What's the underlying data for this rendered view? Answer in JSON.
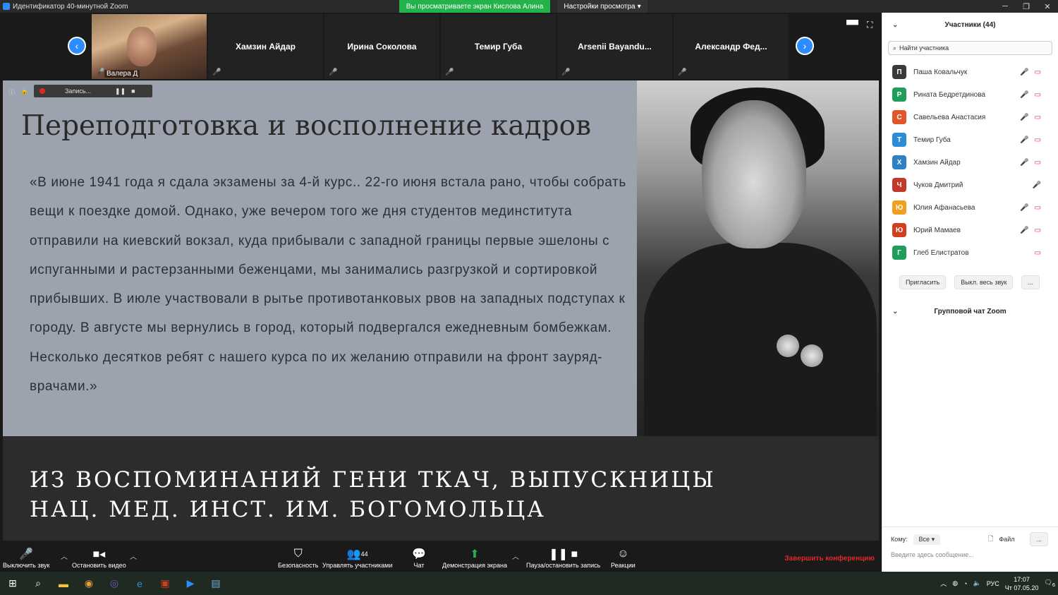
{
  "window": {
    "title": "Идентификатор 40-минутной Zoom",
    "share_notice": "Вы просматриваете экран Кислова Алина",
    "view_options": "Настройки просмотра"
  },
  "video_strip": {
    "self_name": "Валера Д",
    "tiles": [
      "Хамзин Айдар",
      "Ирина Соколова",
      "Темир Губа",
      "Arsenii  Bayandu...",
      "Александр  Фед..."
    ]
  },
  "recording": {
    "label": "Запись..."
  },
  "slide": {
    "title": "Переподготовка и восполнение кадров",
    "quote": "«В июне 1941 года я сдала экзамены за 4-й курс.. 22-го июня встала рано, чтобы собрать вещи к поездке домой. Однако, уже вечером того же дня студентов мединститута отправили на киевский вокзал, куда прибывали с западной границы первые эшелоны с испуганными и растерзанными беженцами, мы занимались разгрузкой и сортировкой прибывших. В июле участвовали в рытье противотанковых рвов на западных подступах к городу. В августе мы вернулись в город, который подвергался ежедневным бомбежкам. Несколько десятков ребят с нашего курса по их желанию отправили на фронт зауряд-врачами.»",
    "caption_line1": "ИЗ ВОСПОМИНАНИЙ  ГЕНИ ТКАЧ, ВЫПУСКНИЦЫ",
    "caption_line2": "НАЦ. МЕД. ИНСТ. ИМ. БОГОМОЛЬЦА"
  },
  "participants": {
    "header": "Участники (44)",
    "search_placeholder": "Найти участника",
    "list": [
      {
        "initial": "П",
        "name": "Паша Ковальчук",
        "color": "#3a3a3a"
      },
      {
        "initial": "Р",
        "name": "Рината Бедретдинова",
        "color": "#1e9e5a"
      },
      {
        "initial": "С",
        "name": "Савельева Анастасия",
        "color": "#e0552a"
      },
      {
        "initial": "Т",
        "name": "Темир Губа",
        "color": "#2d8cd6"
      },
      {
        "initial": "Х",
        "name": "Хамзин Айдар",
        "color": "#2d7fc6"
      },
      {
        "initial": "Ч",
        "name": "Чуков Дмитрий",
        "color": "#c0392b"
      },
      {
        "initial": "Ю",
        "name": "Юлия Афанасьева",
        "color": "#f0a020"
      },
      {
        "initial": "Ю",
        "name": "Юрий Мамаев",
        "color": "#d04020"
      },
      {
        "initial": "Г",
        "name": "Глеб Елистратов",
        "color": "#1e9e5a"
      }
    ],
    "invite": "Пригласить",
    "mute_all": "Выкл. весь звук",
    "more": "..."
  },
  "chat": {
    "header": "Групповой чат Zoom",
    "to_label": "Кому:",
    "to_value": "Все",
    "file": "Файл",
    "more": "...",
    "placeholder": "Введите здесь сообщение..."
  },
  "toolbar": {
    "mute": "Выключить звук",
    "video": "Остановить видео",
    "security": "Безопасность",
    "participants": "Управлять участниками",
    "participants_count": "44",
    "chat": "Чат",
    "share": "Демонстрация экрана",
    "record": "Пауза/остановить запись",
    "reactions": "Реакции",
    "end": "Завершить конференцию"
  },
  "taskbar": {
    "lang": "РУС",
    "time": "17:07",
    "date": "Чт 07.05.20",
    "badge": "6"
  }
}
